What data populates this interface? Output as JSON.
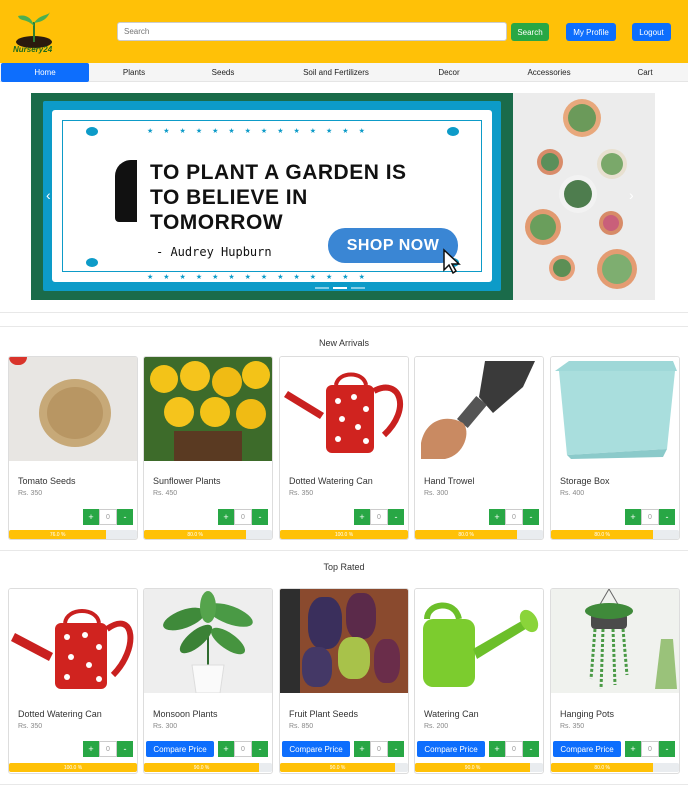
{
  "header": {
    "logo_text": "Nursery24",
    "search_placeholder": "Search",
    "search_button": "Search",
    "profile_button": "My Profile",
    "logout_button": "Logout"
  },
  "nav": {
    "items": [
      "Home",
      "Plants",
      "Seeds",
      "Soil and Fertilizers",
      "Decor",
      "Accessories",
      "Cart"
    ],
    "active": "Home"
  },
  "banner": {
    "quote_line1": "TO PLANT A GARDEN IS",
    "quote_line2": "TO BELIEVE IN",
    "quote_line3": "TOMORROW",
    "author": "- Audrey Hupburn",
    "cta": "SHOP NOW"
  },
  "new_arrivals": {
    "title": "New Arrivals",
    "products": [
      {
        "name": "Tomato Seeds",
        "price": "Rs. 350",
        "qty": "0",
        "rating_label": "76.0 %",
        "rating": 0.76
      },
      {
        "name": "Sunflower Plants",
        "price": "Rs. 450",
        "qty": "0",
        "rating_label": "80.0 %",
        "rating": 0.8
      },
      {
        "name": "Dotted Watering Can",
        "price": "Rs. 350",
        "qty": "0",
        "rating_label": "100.0 %",
        "rating": 1.0
      },
      {
        "name": "Hand Trowel",
        "price": "Rs. 300",
        "qty": "0",
        "rating_label": "80.0 %",
        "rating": 0.8
      },
      {
        "name": "Storage Box",
        "price": "Rs. 400",
        "qty": "0",
        "rating_label": "80.0 %",
        "rating": 0.8
      }
    ]
  },
  "top_rated": {
    "title": "Top Rated",
    "compare_label": "Compare Price",
    "products": [
      {
        "name": "Dotted Watering Can",
        "price": "Rs. 350",
        "qty": "0",
        "rating_label": "100.0 %",
        "rating": 1.0
      },
      {
        "name": "Monsoon Plants",
        "price": "Rs. 300",
        "qty": "0",
        "rating_label": "90.0 %",
        "rating": 0.9
      },
      {
        "name": "Fruit Plant Seeds",
        "price": "Rs. 850",
        "qty": "0",
        "rating_label": "90.0 %",
        "rating": 0.9
      },
      {
        "name": "Watering Can",
        "price": "Rs. 200",
        "qty": "0",
        "rating_label": "90.0 %",
        "rating": 0.9
      },
      {
        "name": "Hanging Pots",
        "price": "Rs. 350",
        "qty": "0",
        "rating_label": "80.0 %",
        "rating": 0.8
      }
    ]
  },
  "colors": {
    "header": "#ffc107",
    "primary": "#0d6efd",
    "success": "#28a745"
  },
  "symbols": {
    "plus": "+",
    "minus": "-",
    "prev": "‹",
    "next": "›"
  }
}
